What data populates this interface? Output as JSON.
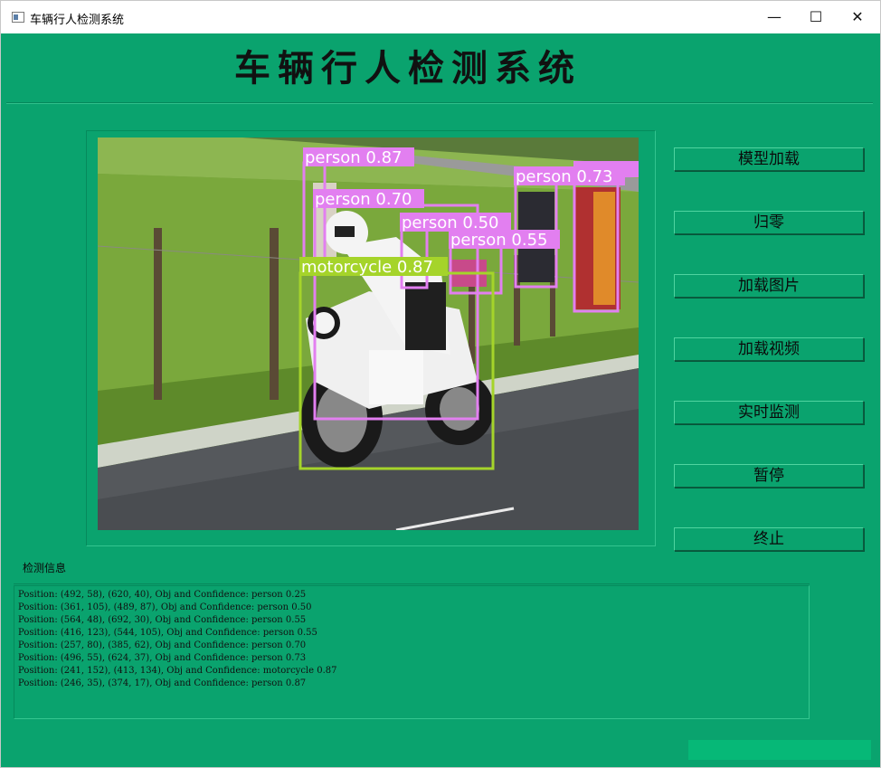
{
  "window": {
    "title": "车辆行人检测系统",
    "controls": {
      "minimize": "—",
      "maximize": "☐",
      "close": "✕"
    }
  },
  "header": {
    "title": "车辆行人检测系统"
  },
  "buttons": {
    "load_model": "模型加载",
    "reset": "归零",
    "load_image": "加载图片",
    "load_video": "加载视频",
    "realtime": "实时监测",
    "pause": "暂停",
    "stop": "终止"
  },
  "detections": [
    {
      "label": "person 0.87",
      "color": "#e27ff0"
    },
    {
      "label": "person 0.70",
      "color": "#e27ff0"
    },
    {
      "label": "person 0.50",
      "color": "#e27ff0"
    },
    {
      "label": "person 0.55",
      "color": "#e27ff0"
    },
    {
      "label": "person 0.73",
      "color": "#e27ff0"
    },
    {
      "label": "motorcycle 0.87",
      "color": "#a5d42a"
    }
  ],
  "info": {
    "title": "检测信息",
    "lines": [
      "Position: (492, 58), (620, 40), Obj and Confidence: person 0.25",
      "Position: (361, 105), (489, 87), Obj and Confidence: person 0.50",
      "Position: (564, 48), (692, 30), Obj and Confidence: person 0.55",
      "Position: (416, 123), (544, 105), Obj and Confidence: person 0.55",
      "Position: (257, 80), (385, 62), Obj and Confidence: person 0.70",
      "Position: (496, 55), (624, 37), Obj and Confidence: person 0.73",
      "Position: (241, 152), (413, 134), Obj and Confidence: motorcycle 0.87",
      "Position: (246, 35), (374, 17), Obj and Confidence: person 0.87"
    ]
  },
  "colors": {
    "background": "#0aa36e",
    "person_box": "#e27ff0",
    "motorcycle_box": "#a5d42a"
  }
}
